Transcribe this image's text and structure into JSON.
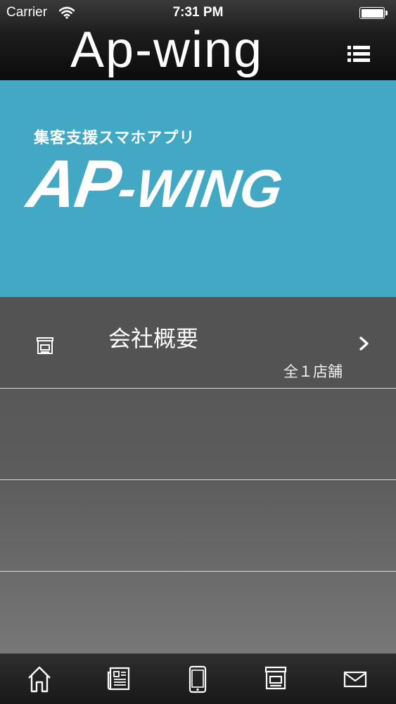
{
  "status_bar": {
    "carrier": "Carrier",
    "time": "7:31 PM",
    "wifi_icon": "wifi-icon",
    "battery_icon": "battery-icon"
  },
  "nav": {
    "title": "Ap-wing",
    "menu_icon": "list-icon"
  },
  "banner": {
    "tagline": "集客支援スマホアプリ",
    "logo_main": "AP",
    "logo_rest": "-WING",
    "background": "#42a8c3"
  },
  "list": {
    "items": [
      {
        "icon": "store-icon",
        "title": "会社概要",
        "subtitle": "全１店舗"
      }
    ]
  },
  "tabbar": {
    "tabs": [
      {
        "icon": "home-icon"
      },
      {
        "icon": "news-icon"
      },
      {
        "icon": "smartphone-icon"
      },
      {
        "icon": "store-icon"
      },
      {
        "icon": "mail-icon"
      }
    ]
  }
}
